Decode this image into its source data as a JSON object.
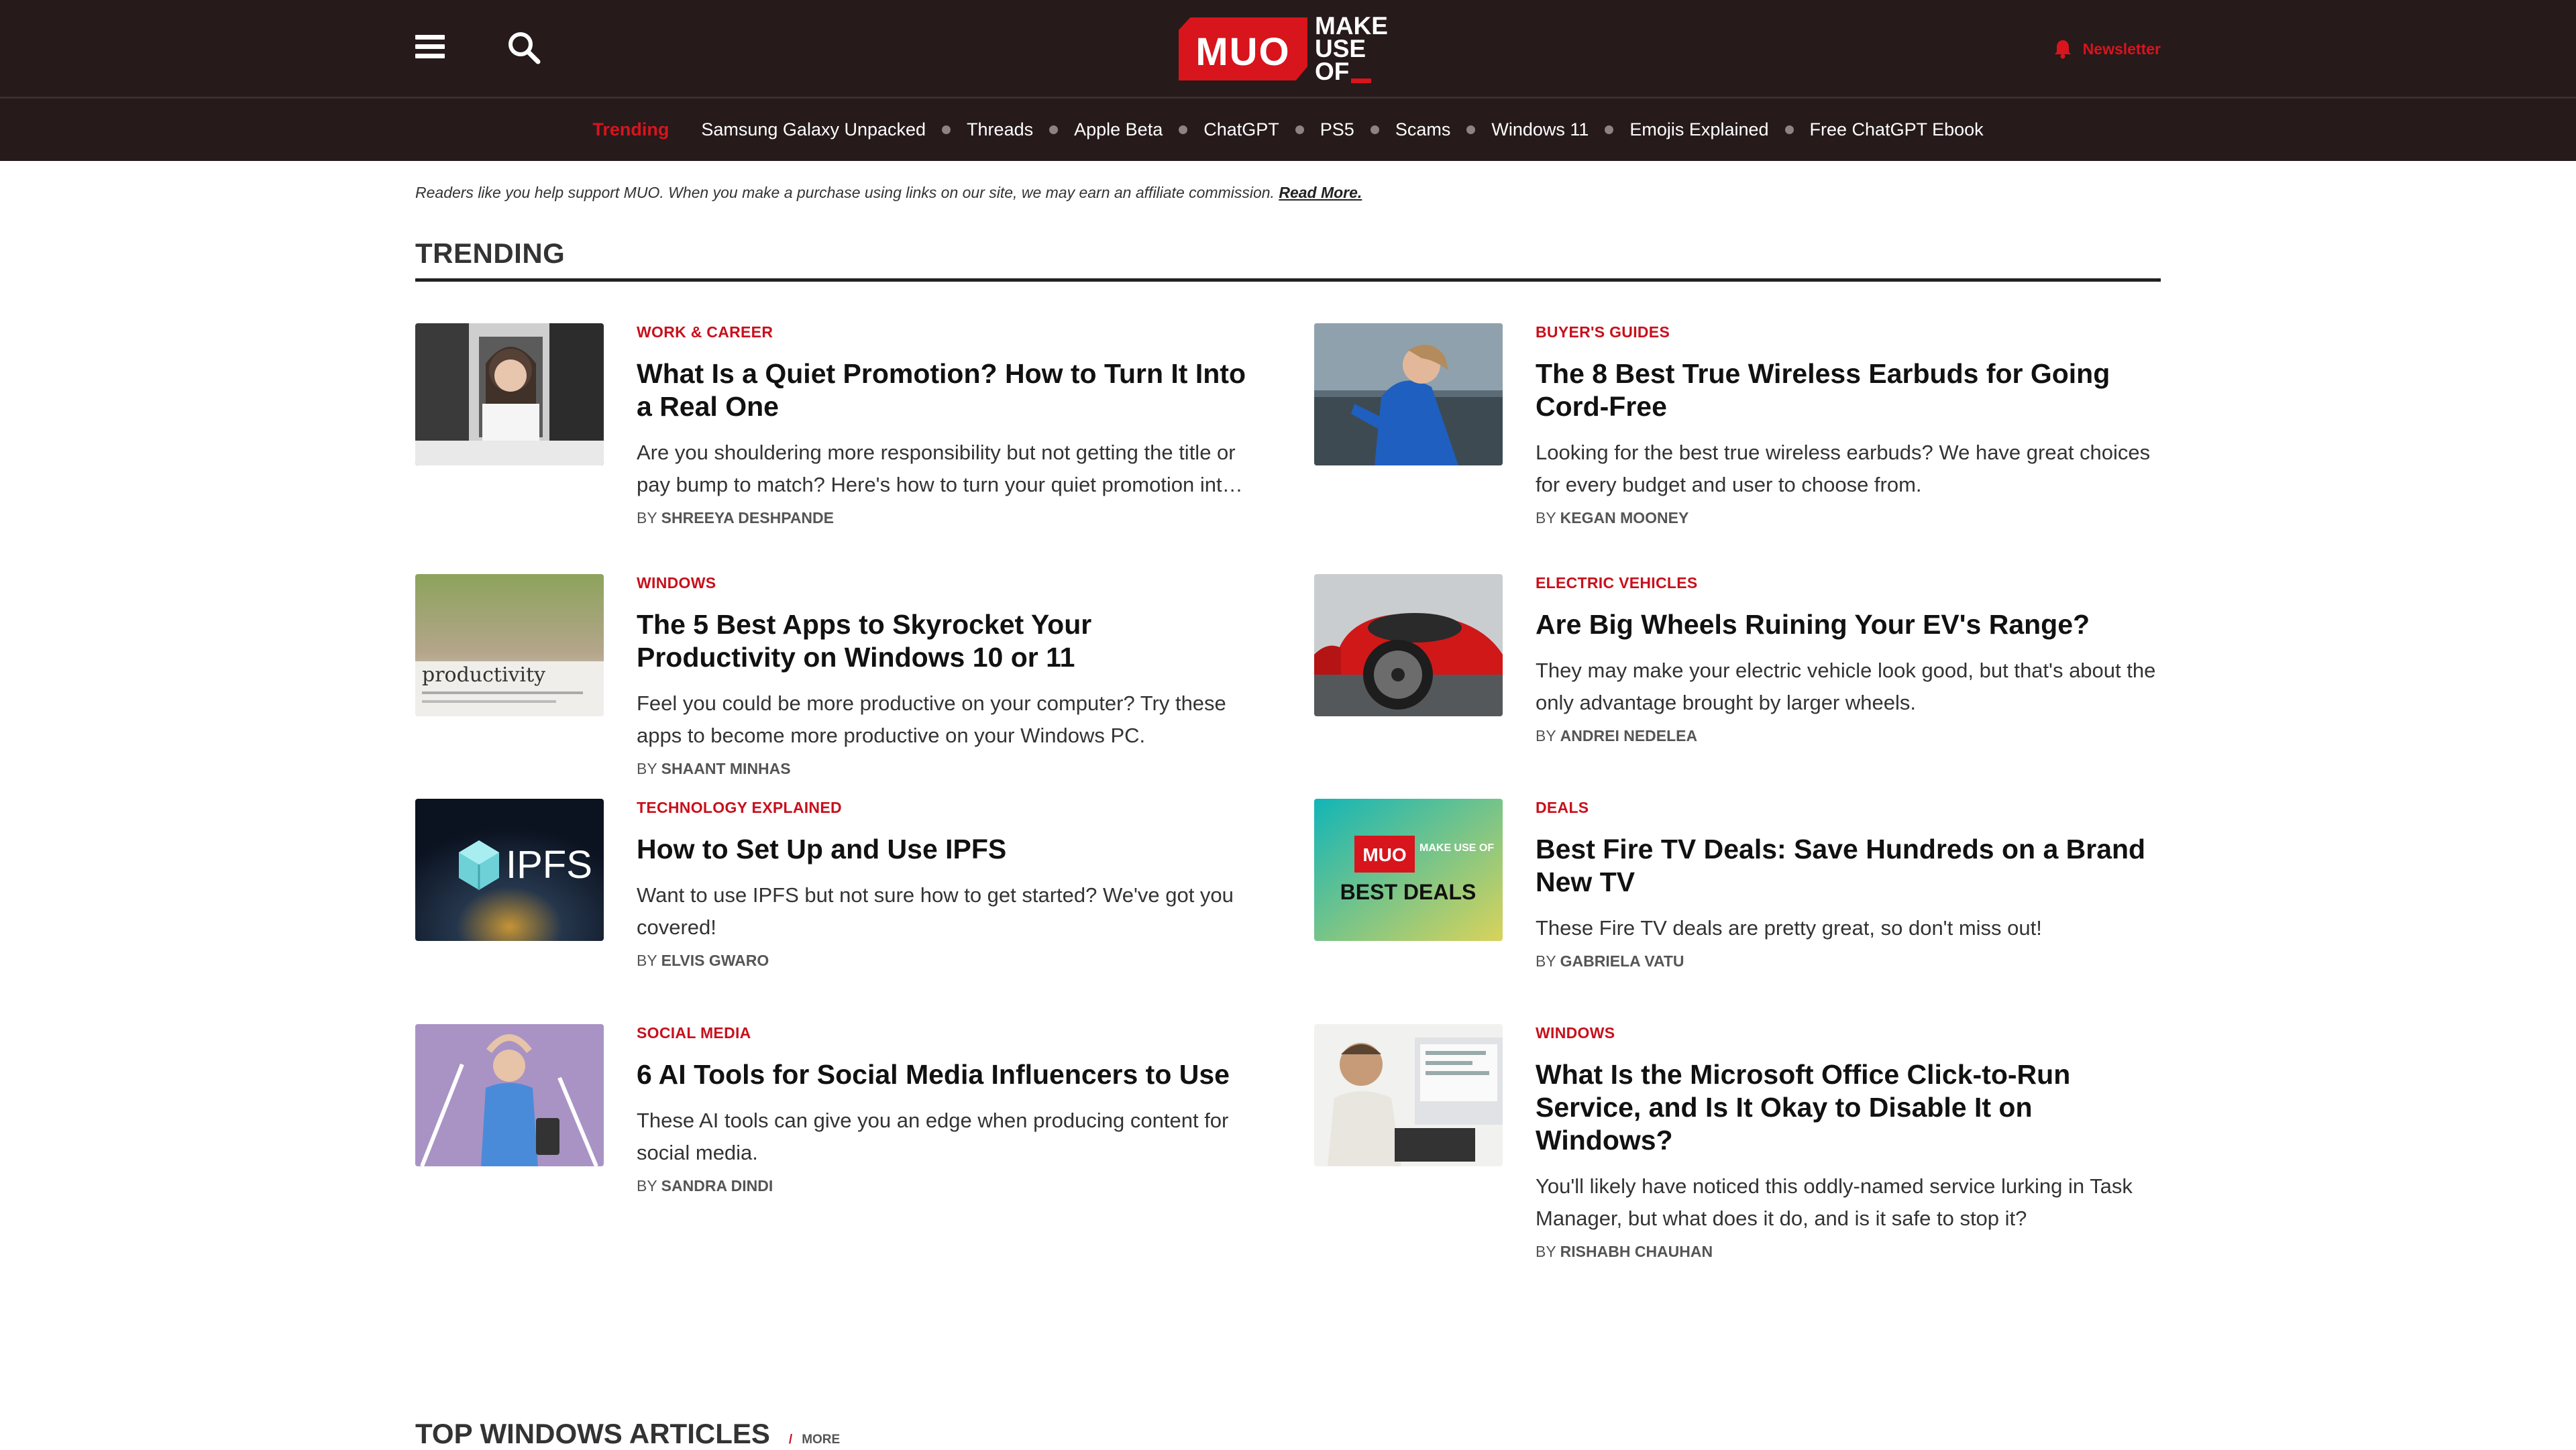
{
  "header": {
    "logo_box_text": "MUO",
    "logo_words": [
      "MAKE",
      "USE",
      "OF"
    ],
    "newsletter_label": "Newsletter"
  },
  "trending_bar": {
    "label": "Trending",
    "items": [
      "Samsung Galaxy Unpacked",
      "Threads",
      "Apple Beta",
      "ChatGPT",
      "PS5",
      "Scams",
      "Windows 11",
      "Emojis Explained",
      "Free ChatGPT Ebook"
    ]
  },
  "disclaimer": {
    "text": "Readers like you help support MUO. When you make a purchase using links on our site, we may earn an affiliate commission.",
    "link": "Read More."
  },
  "trending_section": {
    "title": "TRENDING",
    "articles": [
      {
        "category": "WORK & CAREER",
        "title": "What Is a Quiet Promotion? How to Turn It Into a Real One",
        "excerpt": "Are you shouldering more responsibility but not getting the title or pay bump to match? Here's how to turn your quiet promotion int…",
        "by": "BY",
        "author": "SHREEYA DESHPANDE"
      },
      {
        "category": "BUYER'S GUIDES",
        "title": "The 8 Best True Wireless Earbuds for Going Cord-Free",
        "excerpt": "Looking for the best true wireless earbuds? We have great choices for every budget and user to choose from.",
        "by": "BY",
        "author": "KEGAN MOONEY"
      },
      {
        "category": "WINDOWS",
        "title": "The 5 Best Apps to Skyrocket Your Productivity on Windows 10 or 11",
        "excerpt": "Feel you could be more productive on your computer? Try these apps to become more productive on your Windows PC.",
        "by": "BY",
        "author": "SHAANT MINHAS"
      },
      {
        "category": "ELECTRIC VEHICLES",
        "title": "Are Big Wheels Ruining Your EV's Range?",
        "excerpt": "They may make your electric vehicle look good, but that's about the only advantage brought by larger wheels.",
        "by": "BY",
        "author": "ANDREI NEDELEA"
      },
      {
        "category": "TECHNOLOGY EXPLAINED",
        "title": "How to Set Up and Use IPFS",
        "excerpt": "Want to use IPFS but not sure how to get started? We've got you covered!",
        "by": "BY",
        "author": "ELVIS GWARO"
      },
      {
        "category": "DEALS",
        "title": "Best Fire TV Deals: Save Hundreds on a Brand New TV",
        "excerpt": "These Fire TV deals are pretty great, so don't miss out!",
        "by": "BY",
        "author": "GABRIELA VATU"
      },
      {
        "category": "SOCIAL MEDIA",
        "title": "6 AI Tools for Social Media Influencers to Use",
        "excerpt": "These AI tools can give you an edge when producing content for social media.",
        "by": "BY",
        "author": "SANDRA DINDI"
      },
      {
        "category": "WINDOWS",
        "title": "What Is the Microsoft Office Click-to-Run Service, and Is It Okay to Disable It on Windows?",
        "excerpt": "You'll likely have noticed this oddly-named service lurking in Task Manager, but what does it do, and is it safe to stop it?",
        "by": "BY",
        "author": "RISHABH CHAUHAN"
      }
    ]
  },
  "thumb_texts": {
    "productivity": "productivity",
    "ipfs": "IPFS",
    "deals_logo": "MUO",
    "deals_words": "MAKE USE OF",
    "deals_caption": "BEST DEALS"
  },
  "bottom_section": {
    "title": "TOP WINDOWS ARTICLES",
    "separator": "/",
    "more": "MORE"
  },
  "colors": {
    "header_bg": "#261a1b",
    "accent": "#d8141c",
    "category": "#c8101c"
  }
}
